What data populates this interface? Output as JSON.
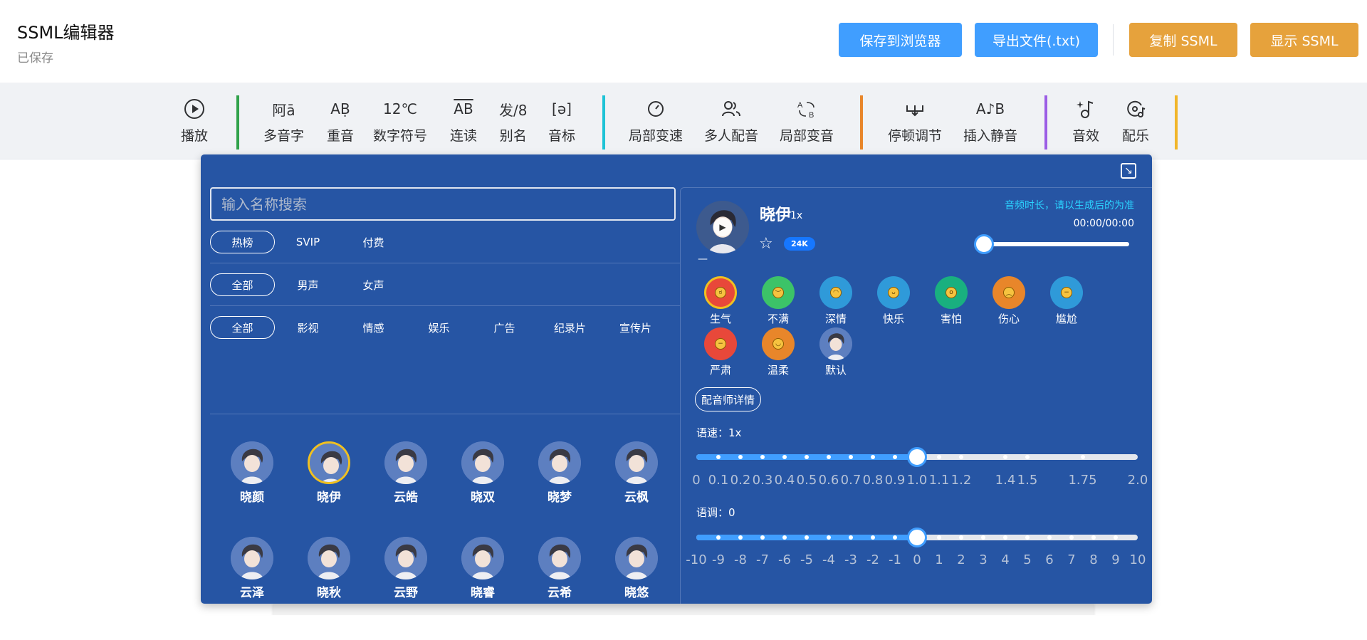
{
  "header": {
    "title": "SSML编辑器",
    "status": "已保存",
    "btn_save_browser": "保存到浏览器",
    "btn_export": "导出文件(.txt)",
    "btn_copy": "复制 SSML",
    "btn_show": "显示 SSML"
  },
  "toolbar": {
    "play": "播放",
    "polyphone": "多音字",
    "stress": "重音",
    "number": "数字符号",
    "liaison": "连读",
    "alias": "别名",
    "phonetic": "音标",
    "local_speed": "局部变速",
    "multi_voice": "多人配音",
    "local_pitch": "局部变音",
    "pause": "停顿调节",
    "silence": "插入静音",
    "sfx": "音效",
    "bgm": "配乐",
    "icons": {
      "polyphone_glyph": "阿ā",
      "stress_glyph": "AḄ",
      "number_glyph": "12℃",
      "liaison_glyph": "AB",
      "alias_glyph": "发/8",
      "phonetic_glyph": "[ə]",
      "silence_glyph": "A♪B"
    }
  },
  "colors": {
    "popup_bg": "#2655a4",
    "primary": "#409eff",
    "warning": "#e6a23c",
    "sep_green": "#30a24a",
    "sep_cyan": "#1ec3d6",
    "sep_orange": "#e8862a",
    "sep_purple": "#9b5de5",
    "sep_yellow": "#f1b62a"
  },
  "search": {
    "placeholder": "输入名称搜索"
  },
  "filters": {
    "tier": [
      "热榜",
      "SVIP",
      "付费"
    ],
    "gender": [
      "全部",
      "男声",
      "女声"
    ],
    "category": [
      "全部",
      "影视",
      "情感",
      "娱乐",
      "广告",
      "纪录片",
      "宣传片"
    ]
  },
  "voices": [
    "晓颜",
    "晓伊",
    "云皓",
    "晓双",
    "晓梦",
    "云枫",
    "云泽",
    "晓秋",
    "云野",
    "晓睿",
    "云希",
    "晓悠"
  ],
  "selected_voice_index": 1,
  "current": {
    "name": "晓伊",
    "rate": "1x",
    "fans": "24K",
    "hint": "音频时长，请以生成后的为准",
    "time": "00:00/00:00",
    "progress": 0,
    "dash": "—"
  },
  "emotions": [
    {
      "label": "生气",
      "color": "#e8483a",
      "face": "ಠ",
      "selected": true
    },
    {
      "label": "不满",
      "color": "#3cc368",
      "face": "︶"
    },
    {
      "label": "深情",
      "color": "#2f9ad9",
      "face": "◠"
    },
    {
      "label": "快乐",
      "color": "#2f9ad9",
      "face": "ᴗ"
    },
    {
      "label": "害怕",
      "color": "#19b07f",
      "face": "o"
    },
    {
      "label": "伤心",
      "color": "#e8862a",
      "face": "︵"
    },
    {
      "label": "尴尬",
      "color": "#2f9ad9",
      "face": "−"
    },
    {
      "label": "严肃",
      "color": "#e8483a",
      "face": "−"
    },
    {
      "label": "温柔",
      "color": "#e8862a",
      "face": "◡"
    },
    {
      "label": "默认",
      "color": "#5d7fc0",
      "face": "avatar"
    }
  ],
  "detail_btn": "配音师详情",
  "speed": {
    "label": "语速：1x",
    "value": 1.0,
    "marks": [
      "0",
      "0.1",
      "0.2",
      "0.3",
      "0.4",
      "0.5",
      "0.6",
      "0.7",
      "0.8",
      "0.9",
      "1.0",
      "1.1",
      "1.2",
      "1.4",
      "1.5",
      "1.75",
      "2.0"
    ],
    "mark_values": [
      0,
      0.1,
      0.2,
      0.3,
      0.4,
      0.5,
      0.6,
      0.7,
      0.8,
      0.9,
      1.0,
      1.1,
      1.2,
      1.4,
      1.5,
      1.75,
      2.0
    ]
  },
  "pitch": {
    "label": "语调：0",
    "value": 0,
    "marks": [
      "-10",
      "-9",
      "-8",
      "-7",
      "-6",
      "-5",
      "-4",
      "-3",
      "-2",
      "-1",
      "0",
      "1",
      "2",
      "3",
      "4",
      "5",
      "6",
      "7",
      "8",
      "9",
      "10"
    ]
  }
}
